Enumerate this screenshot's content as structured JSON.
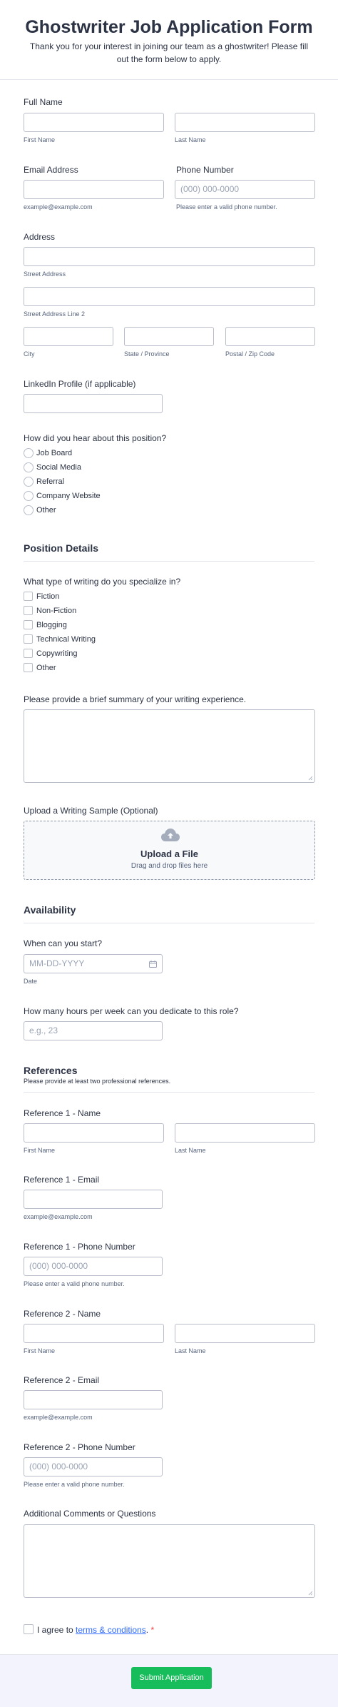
{
  "header": {
    "title": "Ghostwriter Job Application Form",
    "subtitle": "Thank you for your interest in joining our team as a ghostwriter! Please fill out the form below to apply."
  },
  "full_name": {
    "label": "Full Name",
    "first_sub": "First Name",
    "last_sub": "Last Name"
  },
  "email": {
    "label": "Email Address",
    "sub": "example@example.com"
  },
  "phone": {
    "label": "Phone Number",
    "placeholder": "(000) 000-0000",
    "sub": "Please enter a valid phone number."
  },
  "address": {
    "label": "Address",
    "street_sub": "Street Address",
    "street2_sub": "Street Address Line 2",
    "city_sub": "City",
    "state_sub": "State / Province",
    "zip_sub": "Postal / Zip Code"
  },
  "linkedin": {
    "label": "LinkedIn Profile (if applicable)"
  },
  "hear": {
    "label": "How did you hear about this position?",
    "options": [
      "Job Board",
      "Social Media",
      "Referral",
      "Company Website",
      "Other"
    ]
  },
  "position_section": {
    "title": "Position Details"
  },
  "writing_type": {
    "label": "What type of writing do you specialize in?",
    "options": [
      "Fiction",
      "Non-Fiction",
      "Blogging",
      "Technical Writing",
      "Copywriting",
      "Other"
    ]
  },
  "summary": {
    "label": "Please provide a brief summary of your writing experience."
  },
  "upload": {
    "label": "Upload a Writing Sample (Optional)",
    "title": "Upload a File",
    "hint": "Drag and drop files here"
  },
  "availability_section": {
    "title": "Availability"
  },
  "start": {
    "label": "When can you start?",
    "placeholder": "MM-DD-YYYY",
    "sub": "Date"
  },
  "hours": {
    "label": "How many hours per week can you dedicate to this role?",
    "placeholder": "e.g., 23"
  },
  "references_section": {
    "title": "References",
    "subtitle": "Please provide at least two professional references."
  },
  "ref1_name": {
    "label": "Reference 1 - Name",
    "first_sub": "First Name",
    "last_sub": "Last Name"
  },
  "ref1_email": {
    "label": "Reference 1 - Email",
    "sub": "example@example.com"
  },
  "ref1_phone": {
    "label": "Reference 1 - Phone Number",
    "placeholder": "(000) 000-0000",
    "sub": "Please enter a valid phone number."
  },
  "ref2_name": {
    "label": "Reference 2 - Name",
    "first_sub": "First Name",
    "last_sub": "Last Name"
  },
  "ref2_email": {
    "label": "Reference 2 - Email",
    "sub": "example@example.com"
  },
  "ref2_phone": {
    "label": "Reference 2 - Phone Number",
    "placeholder": "(000) 000-0000",
    "sub": "Please enter a valid phone number."
  },
  "comments": {
    "label": "Additional Comments or Questions"
  },
  "terms": {
    "prefix": "I agree to ",
    "link": "terms & conditions",
    "suffix": ".",
    "required_mark": "*"
  },
  "submit": {
    "label": "Submit Application"
  },
  "colors": {
    "accent": "#18bd5b",
    "link": "#2e69ff",
    "required": "#f23a3c",
    "text": "#2c3345",
    "border": "#b8bdc9"
  }
}
